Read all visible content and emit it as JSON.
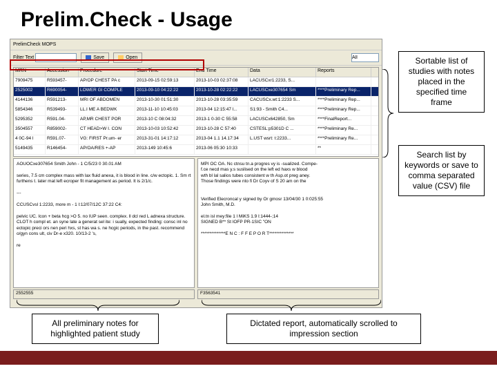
{
  "slide": {
    "title": "Prelim.Check - Usage"
  },
  "toolbar": {
    "menu_label": "PrelimCheck MOPS",
    "filter_label": "Filter Text",
    "save_label": "Save",
    "open_label": "Open",
    "search_placeholder": "",
    "dropdown_label": "All"
  },
  "grid": {
    "headers": [
      "MRN",
      "Accession",
      "Procedure",
      "Start Time",
      "End Time",
      "Data",
      "Reports"
    ],
    "rows": [
      {
        "c": [
          "7909475",
          "R593457-",
          "AP/OP CHEST PA c",
          "2013-09-15 02:59:13",
          "2013-10-03 02:37:08",
          "LACUSCxr1:2233, S...",
          ""
        ]
      },
      {
        "c": [
          "2525002",
          "R690054-",
          "LOWER GI COMPLE",
          "2013-09-10 04:22:22",
          "2013-10-28 02:22:22",
          "LACUSCxe307654 Sm",
          "****Preliminary Rep..."
        ],
        "sel": true
      },
      {
        "c": [
          "4144136",
          "R591213-",
          "MRI OF ABDOMEN",
          "2013-10-30 01:51:30",
          "2013-10-28 03:35:59",
          "CACUSCx.wt:1:2233 S...",
          "****Preliminary Rep..."
        ]
      },
      {
        "c": [
          "5854346",
          "R539493-",
          "LL.I ME A BEDWK",
          "2013-11-10  10:45:03",
          "2013-04  12:15:47 l...",
          "S1:93 - Smith C4...",
          "****Preliminary Rep..."
        ]
      },
      {
        "c": [
          "5295352",
          "R591.04-",
          "AP,MR CHEST POR",
          "2013-10 C 08:04:32",
          "2013-1 0-30 C 55:58",
          "LACUSCx642850, Sm",
          "****FinalReport..."
        ]
      },
      {
        "c": [
          "3504557",
          "R859002-",
          "CT HEAD>W I. CON",
          "2013-10-03  10:52:42",
          "2013-10-28 C 57:40",
          "CSTESL:p5301D C ...",
          "****Preliminary Re..."
        ]
      },
      {
        "c": [
          "4 0C-94 l",
          "R591.07-",
          "VG: FIRST Pr.um- er",
          "2013-31-01 14:17:12",
          "2013-04 1.1 14.17:34",
          "L.UST wsrt: t:2233...",
          "****Preliminary Re..."
        ]
      },
      {
        "c": [
          "5149435",
          "R146454-",
          "AP/OA/RES +-AP",
          "2013-149  10:45:6",
          "2013-06 05:30 10:33",
          "",
          "**"
        ]
      }
    ]
  },
  "left_pane": {
    "header": "AOUOCxe307654 Smith John - 1 C/5/23 0 30.01 AM",
    "body1": "series, 7.5 cm complex mass with lax fluid anexa, it is blood in line. c/w ectopic. 1. Sm rt furthens t. later mat left ecroper fit management as period. It is 2/1/c.",
    "sep": "---",
    "header2": "CCUSCvsl 1:2233, more m - 1 l:12/07/12C 37:22 C4:",
    "body2": "pelvic UC. Icon + beta hcg >O 5. no IUP seen. complex. ll dcl red L adnexa structure. CLOT h compl et. an syne late a generat sel ite: i sually, expected finding: consc inl no ectopic preci ors nen peri hxs, st has wa s. ne hcgic periods, in the past. recommend o/gyn cons ult, civ Dr-e x320. 10/13-2 's,",
    "footer": "re"
  },
  "right_pane": {
    "l1": "MPI OC OA. Nc ctnsu tn.a progres vy is -sualized. Compe-",
    "l2": "f.ce necd mas y.s suslised on the left ed haxs w blood",
    "l3": "wth bl lal salios tubes consistent w th Asp.ot preg aney.",
    "l4": "Those findings were nto fi Dr Coyv of S 20 am on the",
    "l5": "",
    "l6": "Verified Elecroncal y signed by Or gmosr 13/04/30 1 0:025:55",
    "l7": "John Smith, M.D.",
    "l8": "",
    "l9": "el.tn isl mey:file 1 l MiKS 1.9 l:1444-;14",
    "l10": "SIGNED B** St lOFP PR-1SIC \"ON",
    "l11": "",
    "l12": "**************E N C : F F E P O R T**************"
  },
  "status": {
    "left": "2552555",
    "right": "F3563541"
  },
  "callouts": {
    "c1": "Sortable list of studies with notes placed in the specified time frame",
    "c2": "Search list by keywords or save to comma separated value (CSV) file",
    "c3": "All preliminary notes for highlighted patient study",
    "c4": "Dictated report, automatically scrolled to impression section"
  }
}
